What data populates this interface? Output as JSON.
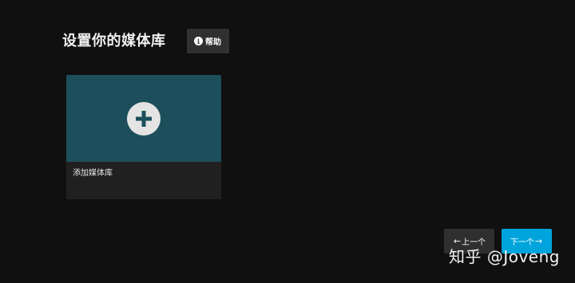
{
  "header": {
    "title": "设置你的媒体库",
    "help_label": "帮助",
    "help_icon": "info-icon"
  },
  "library_card": {
    "label": "添加媒体库",
    "icon": "plus-icon",
    "image_color": "#1c4f5b"
  },
  "navigation": {
    "prev_label": "上一个",
    "next_label": "下一个",
    "prev_arrow": "←",
    "next_arrow": "→",
    "next_color": "#00a4dc"
  },
  "watermark": {
    "text": "知乎 @Joveng"
  }
}
